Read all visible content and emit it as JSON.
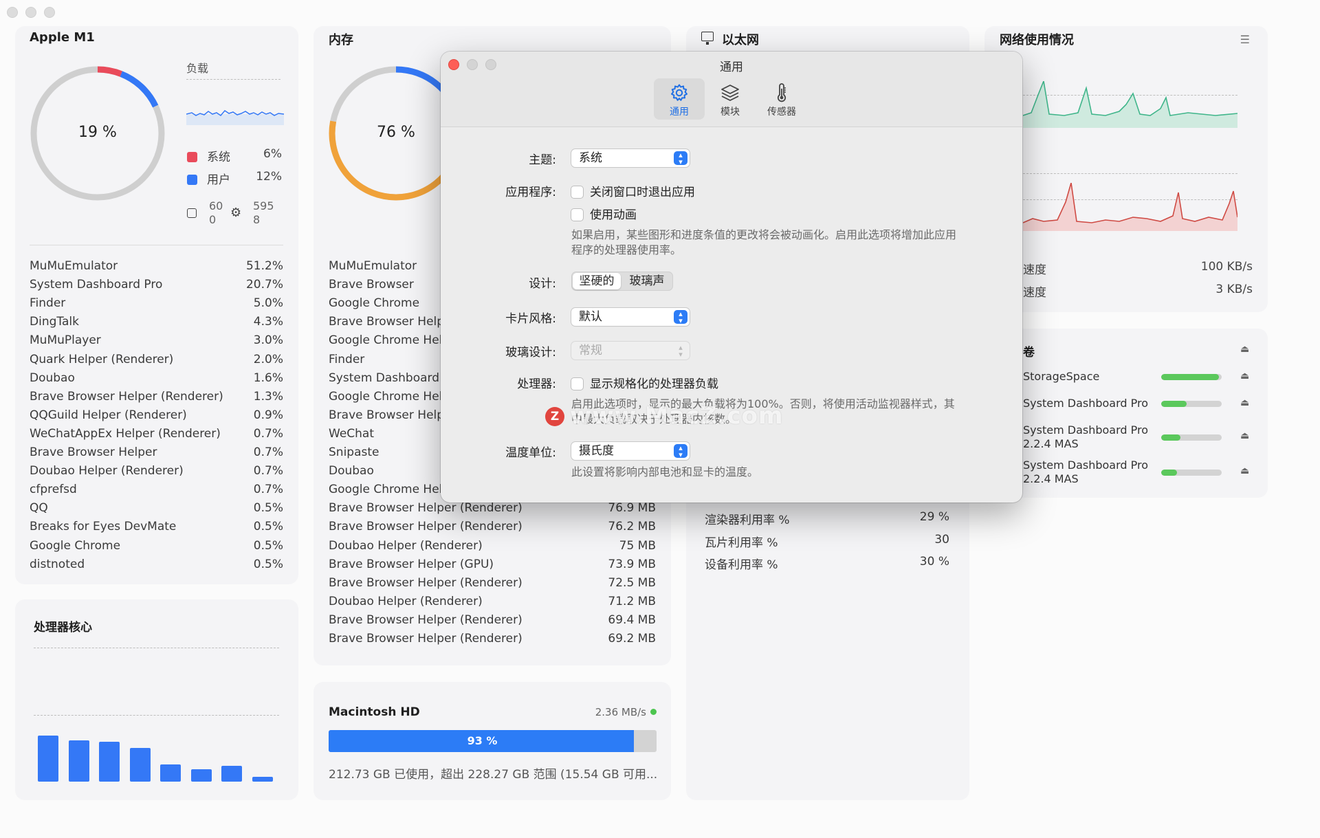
{
  "cpu": {
    "title": "Apple M1",
    "percent": "19 %",
    "load_label": "负载",
    "legend": [
      {
        "label": "系统",
        "value": "6%",
        "color": "#e94b5b"
      },
      {
        "label": "用户",
        "value": "12%",
        "color": "#3478f6"
      }
    ],
    "threads_icon": "square-icon",
    "threads_value": "60\n0",
    "processes_icon": "gear-icon",
    "processes_value": "595\n8",
    "processes": [
      {
        "name": "MuMuEmulator",
        "value": "51.2%"
      },
      {
        "name": "System Dashboard Pro",
        "value": "20.7%"
      },
      {
        "name": "Finder",
        "value": "5.0%"
      },
      {
        "name": "DingTalk",
        "value": "4.3%"
      },
      {
        "name": "MuMuPlayer",
        "value": "3.0%"
      },
      {
        "name": "Quark Helper (Renderer)",
        "value": "2.0%"
      },
      {
        "name": "Doubao",
        "value": "1.6%"
      },
      {
        "name": "Brave Browser Helper (Renderer)",
        "value": "1.3%"
      },
      {
        "name": "QQGuild Helper (Renderer)",
        "value": "0.9%"
      },
      {
        "name": "WeChatAppEx Helper (Renderer)",
        "value": "0.7%"
      },
      {
        "name": "Brave Browser Helper",
        "value": "0.7%"
      },
      {
        "name": "Doubao Helper (Renderer)",
        "value": "0.7%"
      },
      {
        "name": "cfprefsd",
        "value": "0.7%"
      },
      {
        "name": "QQ",
        "value": "0.5%"
      },
      {
        "name": "Breaks for Eyes DevMate",
        "value": "0.5%"
      },
      {
        "name": "Google Chrome",
        "value": "0.5%"
      },
      {
        "name": "distnoted",
        "value": "0.5%"
      }
    ]
  },
  "cores": {
    "title": "处理器核心",
    "values": [
      0.74,
      0.67,
      0.64,
      0.54,
      0.28,
      0.2,
      0.25,
      0.08
    ]
  },
  "memory": {
    "title": "内存",
    "percent": "76 %",
    "processes": [
      {
        "name": "MuMuEmulator",
        "value": ""
      },
      {
        "name": "Brave Browser",
        "value": ""
      },
      {
        "name": "Google Chrome",
        "value": ""
      },
      {
        "name": "Brave Browser Helper",
        "value": ""
      },
      {
        "name": "Google Chrome Helper",
        "value": ""
      },
      {
        "name": "Finder",
        "value": ""
      },
      {
        "name": "System Dashboard Pro",
        "value": ""
      },
      {
        "name": "Google Chrome Helper",
        "value": ""
      },
      {
        "name": "Brave Browser Helper",
        "value": ""
      },
      {
        "name": "WeChat",
        "value": ""
      },
      {
        "name": "Snipaste",
        "value": ""
      },
      {
        "name": "Doubao",
        "value": ""
      },
      {
        "name": "Google Chrome Helper",
        "value": ""
      },
      {
        "name": "Brave Browser Helper (Renderer)",
        "value": "76.9 MB"
      },
      {
        "name": "Brave Browser Helper (Renderer)",
        "value": "76.2 MB"
      },
      {
        "name": "Doubao Helper (Renderer)",
        "value": "75 MB"
      },
      {
        "name": "Brave Browser Helper (GPU)",
        "value": "73.9 MB"
      },
      {
        "name": "Brave Browser Helper (Renderer)",
        "value": "72.5 MB"
      },
      {
        "name": "Doubao Helper (Renderer)",
        "value": "71.2 MB"
      },
      {
        "name": "Brave Browser Helper (Renderer)",
        "value": "69.4 MB"
      },
      {
        "name": "Brave Browser Helper (Renderer)",
        "value": "69.2 MB"
      }
    ]
  },
  "disk": {
    "title": "Macintosh HD",
    "speed": "2.36 MB/s",
    "percent_label": "93 %",
    "fill": 0.93,
    "summary": "212.73 GB 已使用，超出 228.27 GB 范围 (15.54 GB 可用..."
  },
  "ethernet": {
    "title": "以太网",
    "stats": [
      {
        "name": "渲染器利用率 %",
        "value": "29 %"
      },
      {
        "name": "瓦片利用率 %",
        "value": "30"
      },
      {
        "name": "设备利用率 %",
        "value": "30 %"
      }
    ]
  },
  "network": {
    "title": "网络使用情况",
    "download_label": "速度",
    "download_value": "100 KB/s",
    "upload_label": "速度",
    "upload_value": "3 KB/s"
  },
  "volumes": {
    "title": "卷",
    "items": [
      {
        "name": "StorageSpace",
        "fill": 0.95
      },
      {
        "name": "System Dashboard Pro",
        "fill": 0.42
      },
      {
        "name": "System Dashboard Pro\n2.2.4 MAS",
        "fill": 0.32
      },
      {
        "name": "System Dashboard Pro\n2.2.4 MAS",
        "fill": 0.26
      }
    ]
  },
  "watermark": "www.MacZ.com",
  "dialog": {
    "title": "通用",
    "tabs": [
      {
        "label": "通用",
        "icon": "gear-icon"
      },
      {
        "label": "模块",
        "icon": "layers-icon"
      },
      {
        "label": "传感器",
        "icon": "thermometer-icon"
      }
    ],
    "theme_label": "主题:",
    "theme_value": "系统",
    "app_label": "应用程序:",
    "quit_on_close": "关闭窗口时退出应用",
    "use_animation": "使用动画",
    "animation_hint": "如果启用，某些图形和进度条值的更改将会被动画化。启用此选项将增加此应用程序的处理器使用率。",
    "design_label": "设计:",
    "design_options": [
      "坚硬的",
      "玻璃声"
    ],
    "card_style_label": "卡片风格:",
    "card_style_value": "默认",
    "glass_label": "玻璃设计:",
    "glass_value": "常规",
    "processor_label": "处理器:",
    "normalized_load": "显示规格化的处理器负载",
    "processor_hint": "启用此选项时，显示的最大负载将为100%。否则，将使用活动监视器样式，其中最大负载取决于处理器内核数。",
    "temp_label": "温度单位:",
    "temp_value": "摄氏度",
    "temp_hint": "此设置将影响内部电池和显卡的温度。"
  }
}
